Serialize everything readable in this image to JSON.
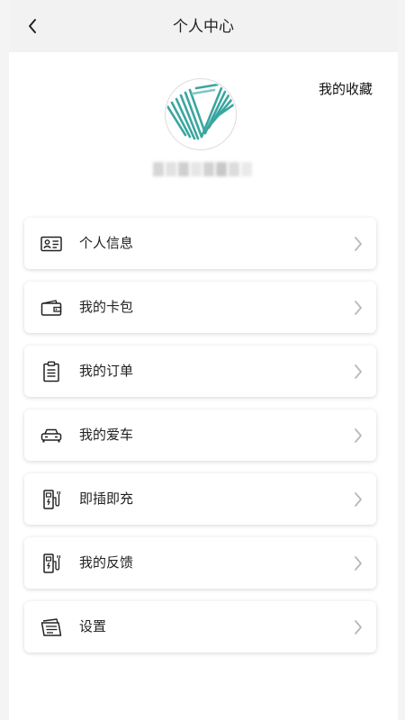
{
  "header": {
    "title": "个人中心",
    "back_icon": "chevron-left-icon"
  },
  "profile": {
    "favorites_label": "我的收藏",
    "avatar_icon": "logo-avatar"
  },
  "menu": {
    "items": [
      {
        "label": "个人信息",
        "icon": "id-card-icon"
      },
      {
        "label": "我的卡包",
        "icon": "wallet-icon"
      },
      {
        "label": "我的订单",
        "icon": "clipboard-icon"
      },
      {
        "label": "我的爱车",
        "icon": "car-icon"
      },
      {
        "label": "即插即充",
        "icon": "charging-station-icon"
      },
      {
        "label": "我的反馈",
        "icon": "charging-station-icon"
      },
      {
        "label": "设置",
        "icon": "settings-card-icon"
      }
    ],
    "arrow_icon": "chevron-right-icon"
  },
  "colors": {
    "accent_teal": "#3aa6a0",
    "text_primary": "#222222",
    "arrow": "#b8b8b8"
  }
}
